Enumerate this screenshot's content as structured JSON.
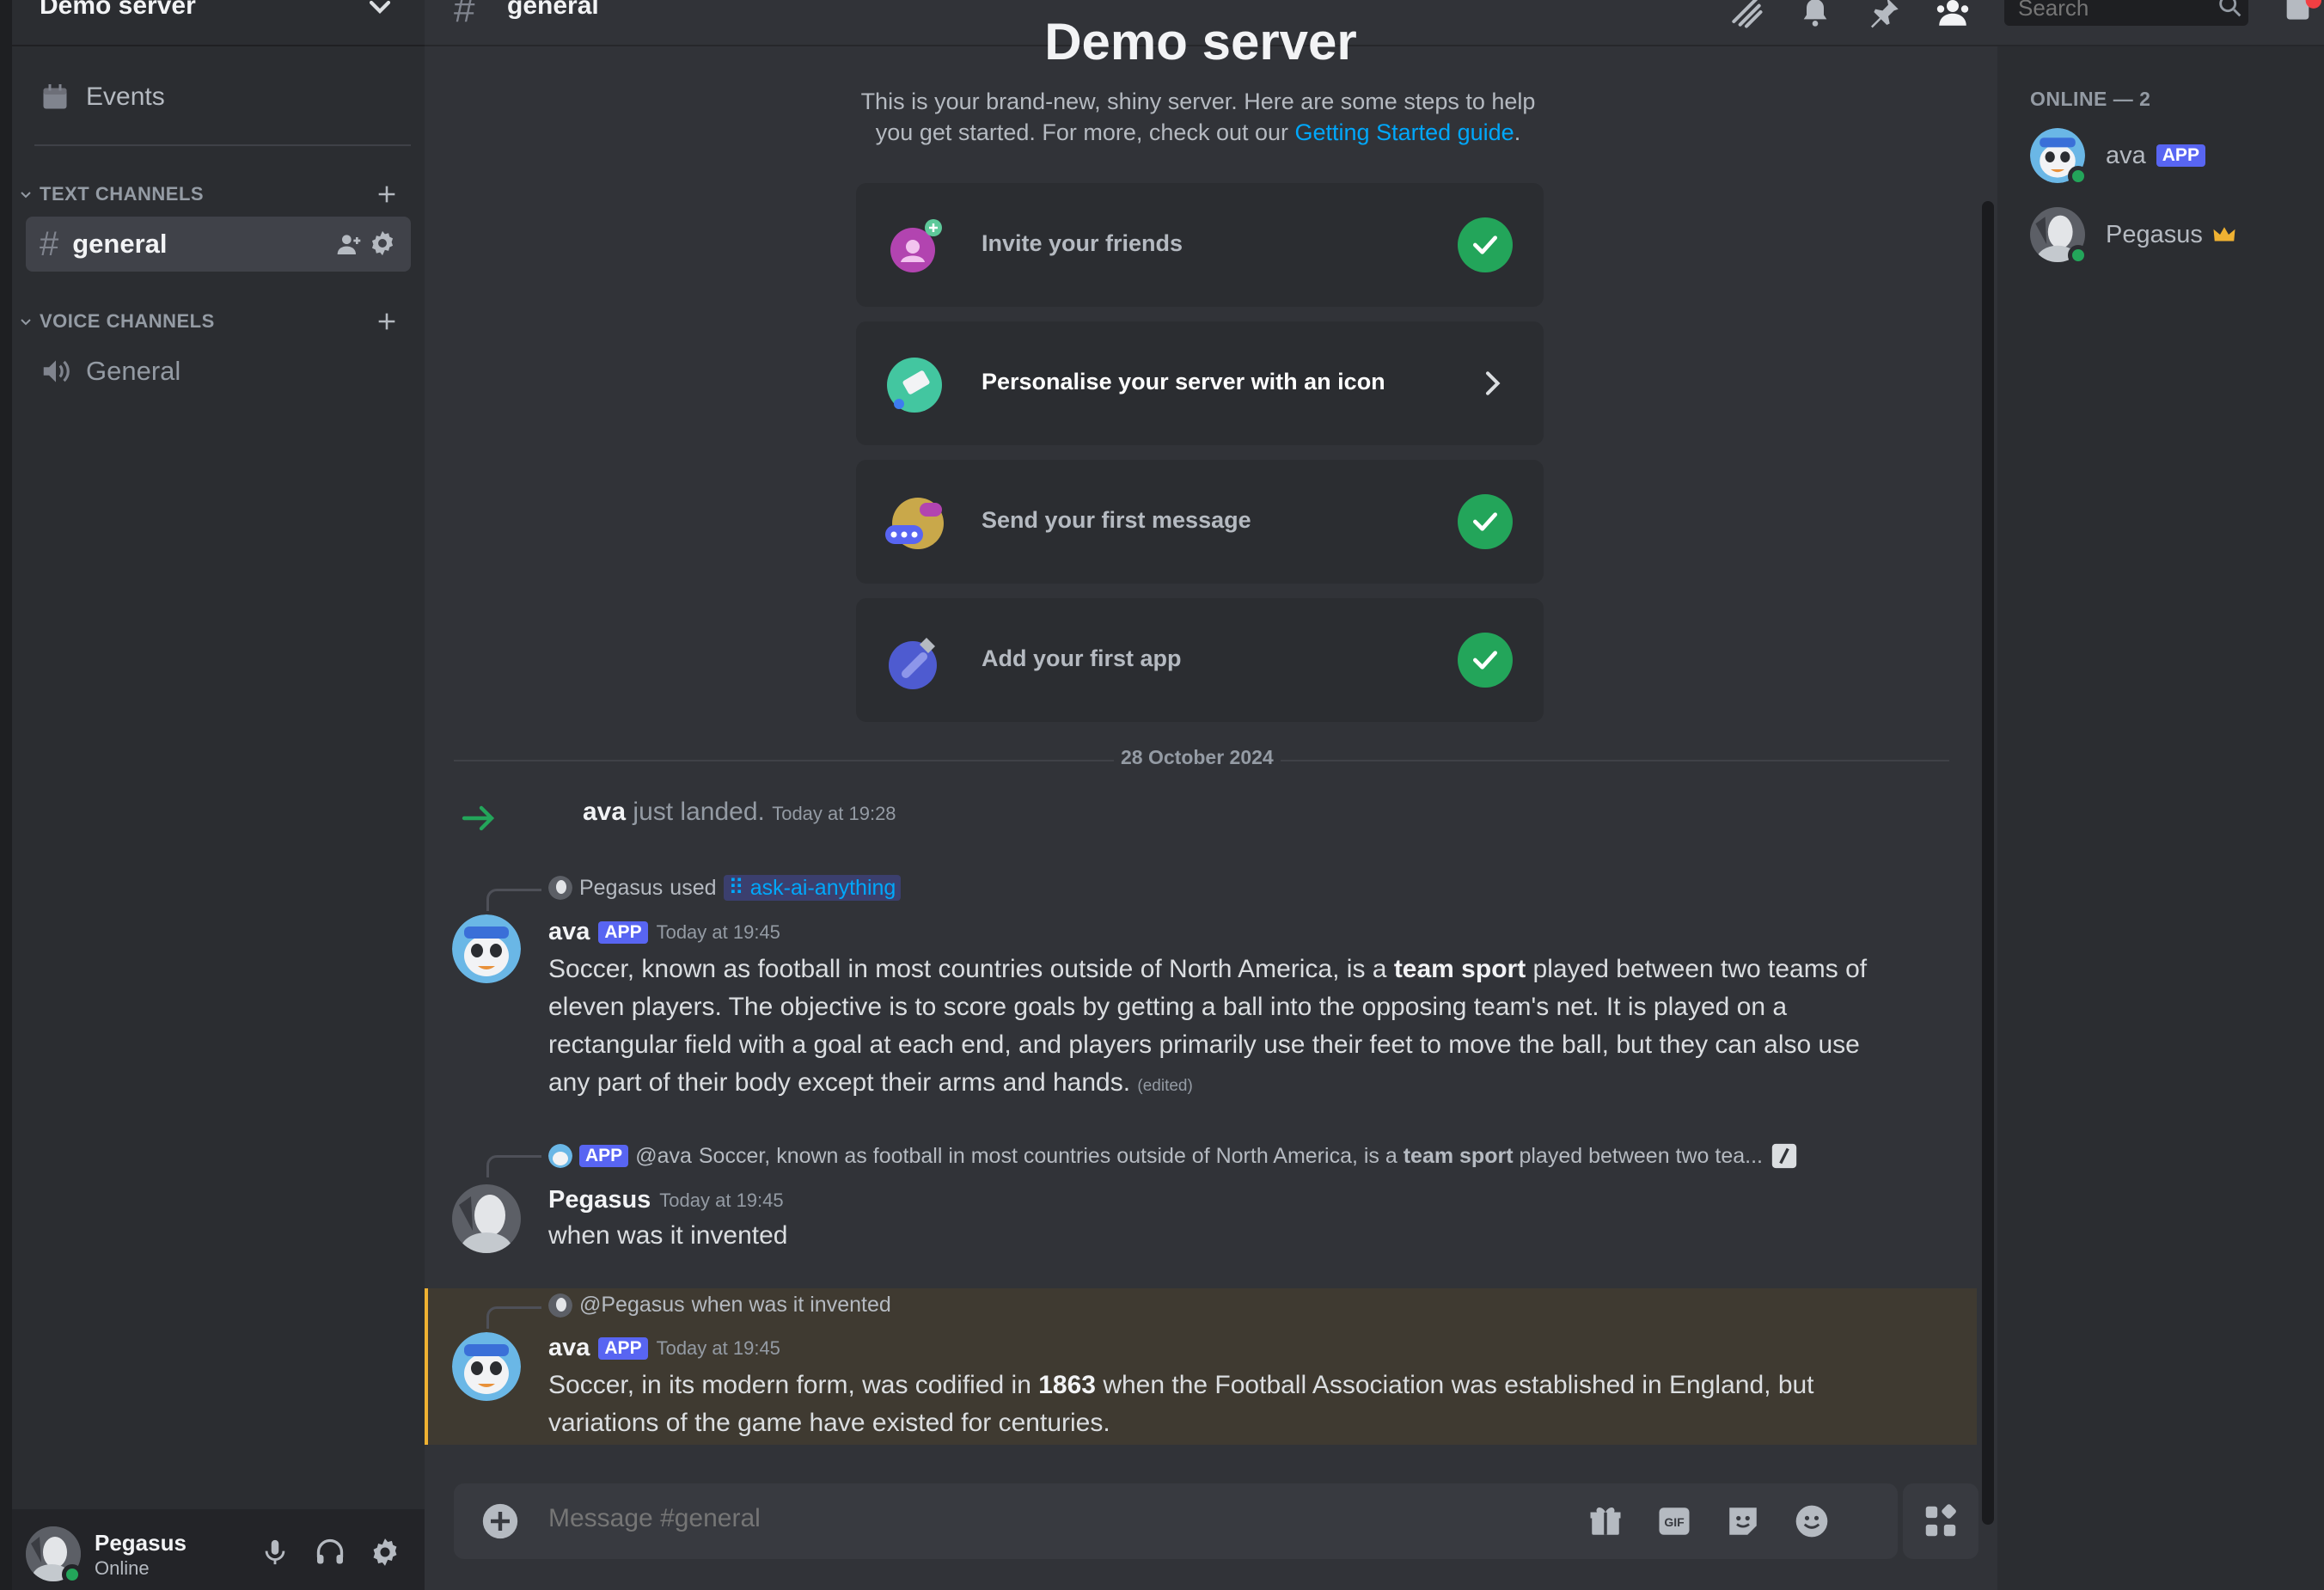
{
  "colors": {
    "accent": "#5865f2",
    "online": "#23a55a",
    "link": "#00a8fc",
    "mention_highlight": "#f0b232",
    "crown": "#f0b232"
  },
  "sidebar": {
    "server_name": "Demo server",
    "events_label": "Events",
    "text_category": "TEXT CHANNELS",
    "voice_category": "VOICE CHANNELS",
    "text_channels": [
      {
        "hash": "#",
        "label": "general"
      }
    ],
    "voice_channels": [
      {
        "label": "General"
      }
    ]
  },
  "user_panel": {
    "name": "Pegasus",
    "status": "Online"
  },
  "topbar": {
    "hash": "#",
    "channel_name": "general",
    "search_placeholder": "Search",
    "icons": [
      "threads-icon",
      "notification-bell-icon",
      "pin-icon",
      "member-list-icon",
      "search-icon",
      "inbox-icon"
    ]
  },
  "welcome": {
    "title": "Demo server",
    "text": "This is your brand-new, shiny server. Here are some steps to help you get started. For more, check out our ",
    "link": "Getting Started guide",
    "text_end": ".",
    "tasks": [
      {
        "label": "Invite your friends",
        "done": true,
        "icon": "invite-friends-icon"
      },
      {
        "label": "Personalise your server with an icon",
        "done": false,
        "icon": "personalise-icon"
      },
      {
        "label": "Send your first message",
        "done": true,
        "icon": "first-message-icon"
      },
      {
        "label": "Add your first app",
        "done": true,
        "icon": "first-app-icon"
      }
    ]
  },
  "date_divider": "28 October 2024",
  "join_message": {
    "name": "ava",
    "text": "just landed.",
    "timestamp": "Today at 19:28"
  },
  "messages": [
    {
      "reply": {
        "user": "Pegasus",
        "used": "used",
        "command": "ask-ai-anything"
      },
      "author": "ava",
      "badge": "APP",
      "timestamp": "Today at 19:45",
      "body_before": "Soccer, known as football in most countries outside of North America, is a ",
      "body_bold": "team sport",
      "body_after": " played between two teams of eleven players. The objective is to score goals by getting a ball into the opposing team's net. It is played on a rectangular field with a goal at each end, and players primarily use their feet to move the ball, but they can also use any part of their body except their arms and hands.",
      "edited": "(edited)"
    },
    {
      "reply": {
        "badge": "APP",
        "mention": "@ava",
        "text_before": "Soccer, known as football in most countries outside of North America, is a ",
        "text_bold": "team sport",
        "text_after": " played between two tea..."
      },
      "author": "Pegasus",
      "timestamp": "Today at 19:45",
      "body": "when was it invented"
    },
    {
      "reply": {
        "mention": "@Pegasus",
        "text": "when was it invented"
      },
      "author": "ava",
      "badge": "APP",
      "timestamp": "Today at 19:45",
      "body_before": "Soccer, in its modern form, was codified in ",
      "body_bold": "1863",
      "body_after": " when the Football Association was established in England, but variations of the game have existed for centuries."
    }
  ],
  "composer": {
    "placeholder": "Message #general"
  },
  "members": {
    "heading": "ONLINE — 2",
    "list": [
      {
        "name": "ava",
        "badge": "APP"
      },
      {
        "name": "Pegasus",
        "owner": true
      }
    ]
  }
}
